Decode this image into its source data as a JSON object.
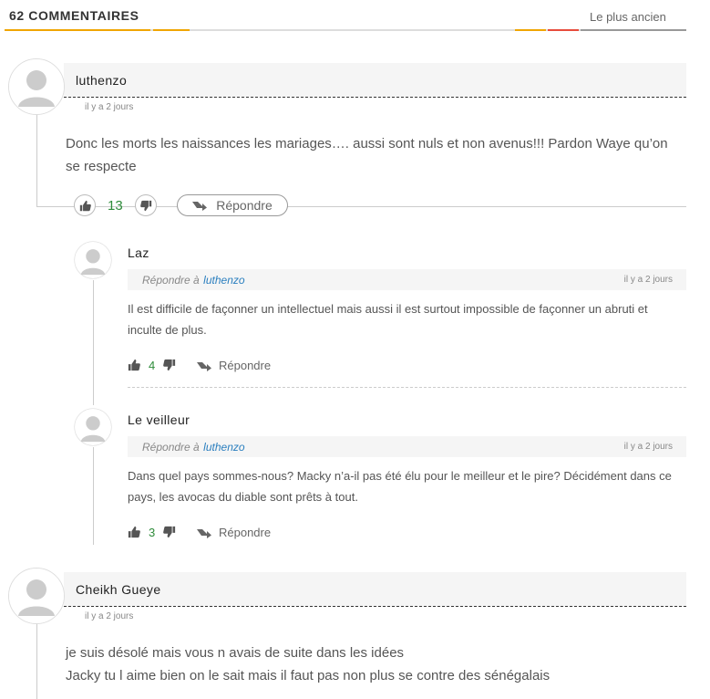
{
  "header": {
    "comment_count_label": "62 COMMENTAIRES",
    "sort_label": "Le plus ancien",
    "accent_colors": [
      "#f0a500",
      "#e74c3c"
    ]
  },
  "comments": [
    {
      "author": "luthenzo",
      "date": "il y a 2 jours",
      "body": "Donc les morts les naissances les mariages…. aussi sont nuls et non avenus!!! Pardon Waye qu’on se respecte",
      "likes": "13",
      "reply_label": "Répondre",
      "replies": [
        {
          "author": "Laz",
          "reply_prefix": "Répondre à",
          "reply_to": "luthenzo",
          "date": "il y a 2 jours",
          "body": "Il est difficile de façonner un intellectuel mais aussi il est surtout impossible de façonner un abruti et inculte de plus.",
          "likes": "4",
          "reply_label": "Répondre"
        },
        {
          "author": "Le veilleur",
          "reply_prefix": "Répondre à",
          "reply_to": "luthenzo",
          "date": "il y a 2 jours",
          "body": "Dans quel pays sommes-nous? Macky n’a-il pas été élu pour le meilleur et le pire? Décidément dans ce pays, les avocas du diable sont prêts à tout.",
          "likes": "3",
          "reply_label": "Répondre"
        }
      ]
    },
    {
      "author": "Cheikh Gueye",
      "date": "il y a 2 jours",
      "body_lines": [
        "je suis désolé mais vous n avais de suite dans les idées",
        "Jacky tu l aime bien on le sait mais il faut pas non plus se contre des sénégalais"
      ]
    }
  ],
  "icons": {
    "avatar": "user-avatar-icon",
    "like": "thumbs-up-icon",
    "dislike": "thumbs-down-icon",
    "reply": "reply-arrow-icon"
  }
}
